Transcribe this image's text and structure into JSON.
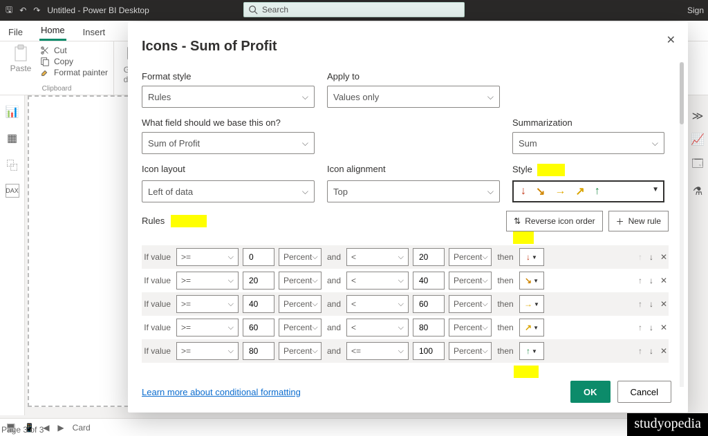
{
  "app": {
    "title": "Untitled - Power BI Desktop",
    "signin": "Sign",
    "search_placeholder": "Search"
  },
  "tabs": {
    "file": "File",
    "home": "Home",
    "insert": "Insert"
  },
  "ribbon": {
    "paste": "Paste",
    "cut": "Cut",
    "copy": "Copy",
    "format_painter": "Format painter",
    "clipboard": "Clipboard",
    "get_data": "Get\ndata ▾"
  },
  "status": {
    "page_of": "Page 3 of 3",
    "card": "Card"
  },
  "modal": {
    "title": "Icons - Sum of Profit",
    "format_style_lbl": "Format style",
    "format_style": "Rules",
    "apply_to_lbl": "Apply to",
    "apply_to": "Values only",
    "base_field_lbl": "What field should we base this on?",
    "base_field": "Sum of Profit",
    "summarization_lbl": "Summarization",
    "summarization": "Sum",
    "icon_layout_lbl": "Icon layout",
    "icon_layout": "Left of data",
    "icon_align_lbl": "Icon alignment",
    "icon_align": "Top",
    "style_lbl": "Style",
    "rules_lbl": "Rules",
    "reverse": "Reverse icon order",
    "new_rule": "New rule",
    "if_value": "If value",
    "and": "and",
    "then": "then",
    "percent": "Percent",
    "rows": [
      {
        "op1": ">=",
        "v1": "0",
        "op2": "<",
        "v2": "20",
        "glyph": "↓",
        "color": "c-red"
      },
      {
        "op1": ">=",
        "v1": "20",
        "op2": "<",
        "v2": "40",
        "glyph": "↘",
        "color": "c-oran"
      },
      {
        "op1": ">=",
        "v1": "40",
        "op2": "<",
        "v2": "60",
        "glyph": "→",
        "color": "c-amber"
      },
      {
        "op1": ">=",
        "v1": "60",
        "op2": "<",
        "v2": "80",
        "glyph": "↗",
        "color": "c-gold"
      },
      {
        "op1": ">=",
        "v1": "80",
        "op2": "<=",
        "v2": "100",
        "glyph": "↑",
        "color": "c-green"
      }
    ],
    "learn": "Learn more about conditional formatting",
    "ok": "OK",
    "cancel": "Cancel"
  },
  "watermark": "studyopedia"
}
